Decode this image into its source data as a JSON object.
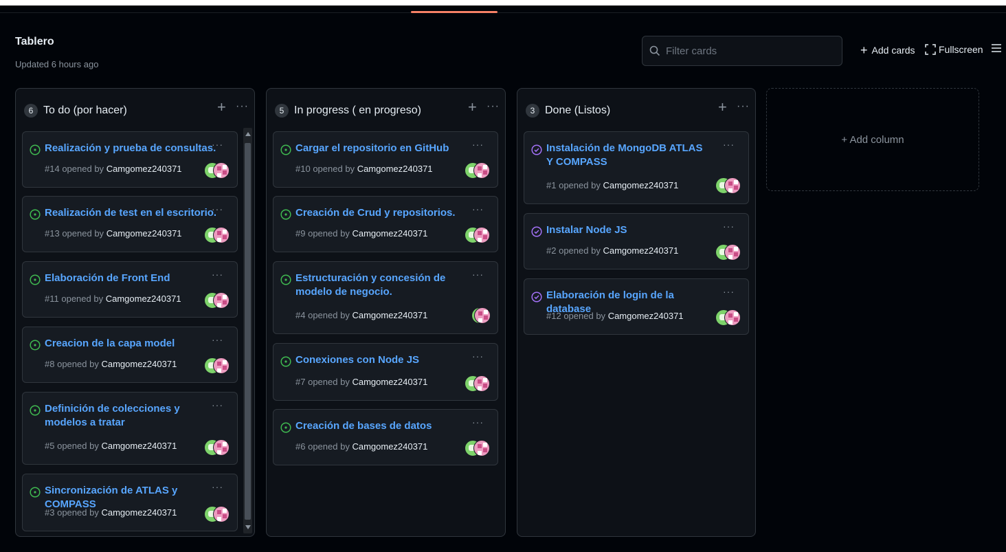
{
  "board": {
    "title": "Tablero",
    "updated": "Updated 6 hours ago"
  },
  "toolbar": {
    "filter_placeholder": "Filter cards",
    "add_cards": "Add cards",
    "fullscreen": "Fullscreen"
  },
  "colors": {
    "open": "#3fb950",
    "closed": "#a371f7",
    "link": "#58a6ff",
    "accent": "#f78166"
  },
  "columns": [
    {
      "count": "6",
      "title": "To do (por hacer)",
      "cards": [
        {
          "title": "Realización y prueba de consultas.",
          "number": "#14",
          "opened_by": "opened by",
          "author": "Camgomez240371",
          "status": "open"
        },
        {
          "title": "Realización de test en el escritorio.",
          "number": "#13",
          "opened_by": "opened by",
          "author": "Camgomez240371",
          "status": "open"
        },
        {
          "title": "Elaboración de Front End",
          "number": "#11",
          "opened_by": "opened by",
          "author": "Camgomez240371",
          "status": "open"
        },
        {
          "title": "Creacion de la capa model",
          "number": "#8",
          "opened_by": "opened by",
          "author": "Camgomez240371",
          "status": "open"
        },
        {
          "title": "Definición de colecciones y modelos a tratar",
          "number": "#5",
          "opened_by": "opened by",
          "author": "Camgomez240371",
          "status": "open"
        },
        {
          "title": "Sincronización de ATLAS y COMPASS",
          "number": "#3",
          "opened_by": "opened by",
          "author": "Camgomez240371",
          "status": "open"
        }
      ]
    },
    {
      "count": "5",
      "title": "In progress ( en progreso)",
      "cards": [
        {
          "title": "Cargar el repositorio en GitHub",
          "number": "#10",
          "opened_by": "opened by",
          "author": "Camgomez240371",
          "status": "open"
        },
        {
          "title": "Creación de Crud y repositorios.",
          "number": "#9",
          "opened_by": "opened by",
          "author": "Camgomez240371",
          "status": "open"
        },
        {
          "title": "Estructuración y concesión de modelo de negocio.",
          "number": "#4",
          "opened_by": "opened by",
          "author": "Camgomez240371",
          "status": "open"
        },
        {
          "title": "Conexiones con Node JS",
          "number": "#7",
          "opened_by": "opened by",
          "author": "Camgomez240371",
          "status": "open"
        },
        {
          "title": "Creación de bases de datos",
          "number": "#6",
          "opened_by": "opened by",
          "author": "Camgomez240371",
          "status": "open"
        }
      ]
    },
    {
      "count": "3",
      "title": "Done (Listos)",
      "cards": [
        {
          "title": "Instalación de MongoDB ATLAS Y COMPASS",
          "number": "#1",
          "opened_by": "opened by",
          "author": "Camgomez240371",
          "status": "closed"
        },
        {
          "title": "Instalar Node JS",
          "number": "#2",
          "opened_by": "opened by",
          "author": "Camgomez240371",
          "status": "closed"
        },
        {
          "title": "Elaboración de login de la database",
          "number": "#12",
          "opened_by": "opened by",
          "author": "Camgomez240371",
          "status": "closed"
        }
      ]
    }
  ],
  "add_column": "Add column"
}
